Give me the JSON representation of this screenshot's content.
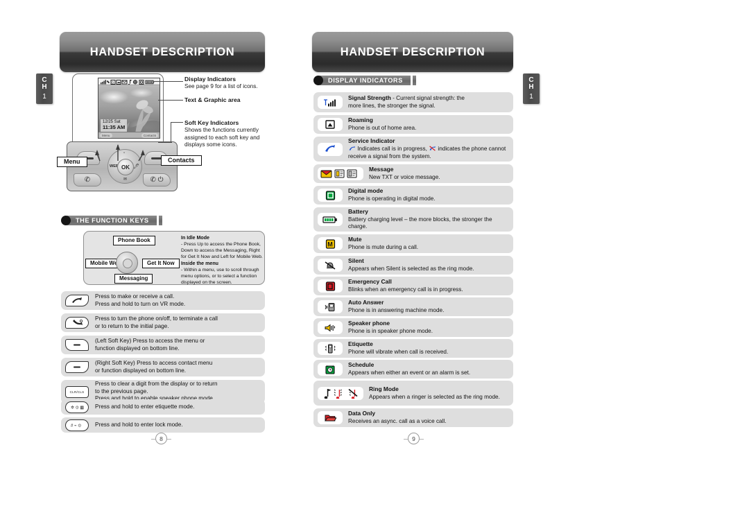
{
  "left_page": {
    "banner_title": "HANDSET DESCRIPTION",
    "chapter_tab": {
      "line1": "C",
      "line2": "H",
      "number": "1"
    },
    "page_number": "8",
    "phone": {
      "status_icons": "icon-strip",
      "date": "12/25 Sat",
      "time": "11:35 AM",
      "softkey_left": "Menu",
      "softkey_right": "Contacts",
      "dpad_center_label": "OK",
      "dpad_left_label": "WEB",
      "callout_menu": "Menu",
      "callout_contacts": "Contacts"
    },
    "annotations": [
      {
        "title": "Display Indicators",
        "body": "See page 9 for a list of icons."
      },
      {
        "title": "Text & Graphic area",
        "body": ""
      },
      {
        "title": "Soft Key Indicators",
        "body": "Shows the functions currently assigned to each soft key and displays some icons."
      }
    ],
    "function_keys_heading": "THE FUNCTION KEYS",
    "function_keys_inset": {
      "label_top": "Phone Book",
      "label_left": "Mobile Web",
      "label_right": "Get It Now",
      "label_bottom": "Messaging",
      "idle_title": "In Idle Mode",
      "idle_body": "- Press Up to access the Phone Book, Down to access the Messaging, Right for Get It Now and Left for Mobile Web.",
      "menu_title": "Inside the menu",
      "menu_body": "- Within a menu, use to scroll through menu options, or to select a function displayed on the screen."
    },
    "key_rows": [
      {
        "icon": "send-key-icon",
        "cap": "",
        "lines": [
          "Press to make or receive a call.",
          "Press and hold to turn on VR mode."
        ]
      },
      {
        "icon": "end-key-icon",
        "cap": "",
        "lines": [
          "Press to turn the phone on/off, to terminate a call",
          "or to return to the initial page."
        ]
      },
      {
        "icon": "left-soft-key-icon",
        "cap": "",
        "lines": [
          "(Left Soft Key) Press to access the menu or",
          "function displayed on bottom line."
        ]
      },
      {
        "icon": "right-soft-key-icon",
        "cap": "",
        "lines": [
          "(Right Soft Key) Press to access contact menu",
          "or function displayed on bottom line."
        ]
      },
      {
        "icon": "clear-key-icon",
        "cap": "CLR/CLS",
        "lines": [
          "Press to clear a digit from the display or to return",
          "to the previous page.",
          "Press and hold to enable speaker phone mode."
        ]
      },
      {
        "icon": "star-key-icon",
        "cap": "",
        "lines": [
          "Press and hold to enter etiquette mode."
        ]
      },
      {
        "icon": "pound-key-icon",
        "cap": "",
        "lines": [
          "Press and hold to enter lock mode."
        ]
      }
    ]
  },
  "right_page": {
    "banner_title": "HANDSET DESCRIPTION",
    "chapter_tab": {
      "line1": "C",
      "line2": "H",
      "number": "1"
    },
    "page_number": "9",
    "display_indicators_heading": "DISPLAY INDICATORS",
    "indicators": [
      {
        "icon": "signal-strength-icon",
        "title": "Signal Strength",
        "dash": " - ",
        "inline": "Current signal strength: the",
        "body": "more lines, the stronger the signal."
      },
      {
        "icon": "roaming-icon",
        "title": "Roaming",
        "dash": "",
        "inline": "",
        "body": "Phone is out of home area."
      },
      {
        "icon": "service-indicator-icon",
        "title": "Service Indicator",
        "dash": "",
        "inline": "",
        "body": "Indicates call is in progress,   indicates the phone cannot receive a signal from the system."
      },
      {
        "icon": "message-icon",
        "title": "Message",
        "dash": "",
        "inline": "",
        "body": "New TXT or voice message."
      },
      {
        "icon": "digital-mode-icon",
        "title": "Digital mode",
        "dash": "",
        "inline": "",
        "body": "Phone is operating in digital mode."
      },
      {
        "icon": "battery-icon",
        "title": "Battery",
        "dash": "",
        "inline": "",
        "body": "Battery charging level – the more blocks, the stronger the charge."
      },
      {
        "icon": "mute-icon",
        "title": "Mute",
        "dash": "",
        "inline": "",
        "body": "Phone is mute during a call."
      },
      {
        "icon": "silent-icon",
        "title": "Silent",
        "dash": "",
        "inline": "",
        "body": "Appears when Silent is selected as the ring mode."
      },
      {
        "icon": "emergency-call-icon",
        "title": "Emergency Call",
        "dash": "",
        "inline": "",
        "body": "Blinks when an emergency call is in progress."
      },
      {
        "icon": "auto-answer-icon",
        "title": "Auto Answer",
        "dash": "",
        "inline": "",
        "body": "Phone is in answering machine mode."
      },
      {
        "icon": "speaker-phone-icon",
        "title": "Speaker phone",
        "dash": "",
        "inline": "",
        "body": "Phone is in speaker phone mode."
      },
      {
        "icon": "etiquette-icon",
        "title": "Etiquette",
        "dash": "",
        "inline": "",
        "body": "Phone will vibrate when call is received."
      },
      {
        "icon": "schedule-icon",
        "title": "Schedule",
        "dash": "",
        "inline": "",
        "body": "Appears when either an event or an alarm is set."
      },
      {
        "icon": "ring-mode-icon",
        "title": "Ring Mode",
        "dash": "",
        "inline": "",
        "body": "Appears when a ringer is selected as the ring mode."
      },
      {
        "icon": "data-only-icon",
        "title": "Data Only",
        "dash": "",
        "inline": "",
        "body": "Receives an async. call as a voice call."
      }
    ]
  },
  "colors": {
    "banner_dark": "#2b2b2b",
    "row_grey": "#dedede",
    "icon_yellow": "#f2c200",
    "icon_green": "#00a33c",
    "icon_red": "#d81f26",
    "icon_blue": "#1a4fd0"
  }
}
